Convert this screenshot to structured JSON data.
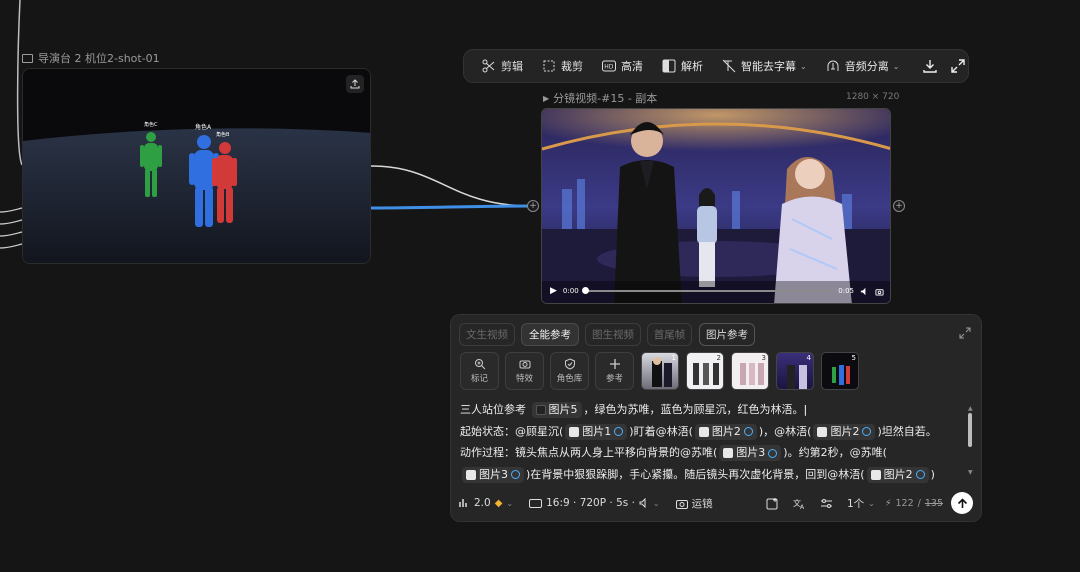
{
  "source_node": {
    "title": "导演台 2 机位2-shot-01",
    "labels": {
      "c": "角色C",
      "a": "角色A",
      "b": "角色B"
    }
  },
  "toolbar": {
    "items": [
      {
        "label": "剪辑",
        "icon": "scissors-icon"
      },
      {
        "label": "裁剪",
        "icon": "crop-icon"
      },
      {
        "label": "高清",
        "icon": "hd-icon"
      },
      {
        "label": "解析",
        "icon": "analyze-icon"
      },
      {
        "label": "智能去字幕",
        "icon": "remove-subtitle-icon"
      },
      {
        "label": "音频分离",
        "icon": "audio-split-icon"
      }
    ]
  },
  "video_node": {
    "title": "分镜视频-#15 - 副本",
    "size": "1280 × 720",
    "time_current": "0:00",
    "time_total": "0:05",
    "progress": 0
  },
  "panel": {
    "tabs": [
      {
        "label": "文生视频",
        "active": false
      },
      {
        "label": "全能参考",
        "active": true
      },
      {
        "label": "图生视频",
        "active": false
      },
      {
        "label": "首尾帧",
        "active": false
      },
      {
        "label": "图片参考",
        "active": false
      }
    ],
    "tools": [
      {
        "label": "标记",
        "icon": "mark-icon"
      },
      {
        "label": "特效",
        "icon": "camera-icon"
      },
      {
        "label": "角色库",
        "icon": "shield-icon"
      },
      {
        "label": "参考",
        "icon": "plus-icon"
      }
    ],
    "thumb_numbers": [
      "1",
      "2",
      "3",
      "4",
      "5"
    ],
    "prompt": {
      "line1_a": "三人站位参考",
      "line1_chip": "图片5",
      "line1_b": "，绿色为苏唯，蓝色为顾星沉，红色为林浯。",
      "line2_a": "起始状态：@顾星沉(",
      "line2_chip1": "图片1",
      "line2_b": ")盯着@林浯(",
      "line2_chip2": "图片2",
      "line2_c": ")，@林浯(",
      "line2_chip3": "图片2",
      "line2_d": ")坦然自若。",
      "line3_a": "动作过程：镜头焦点从两人身上平移向背景的@苏唯(",
      "line3_chip": "图片3",
      "line3_b": ")。约第2秒，@苏唯(",
      "line4_chip1": "图片3",
      "line4_a": ")在背景中狠狠跺脚，手心紧攥。随后镜头再次虚化背景，回到@林浯(",
      "line4_chip2": "图片2",
      "line4_b": ")"
    },
    "bottom": {
      "model": "2.0",
      "format": "16:9 · 720P · 5s ·",
      "camera": "运镜",
      "count": "1个",
      "credits_used": "122",
      "credits_total": "135"
    }
  },
  "colors": {
    "accent": "#4ab0ff",
    "figure_green": "#2ea043",
    "figure_blue": "#2f6fe0",
    "figure_red": "#d23a3a"
  }
}
